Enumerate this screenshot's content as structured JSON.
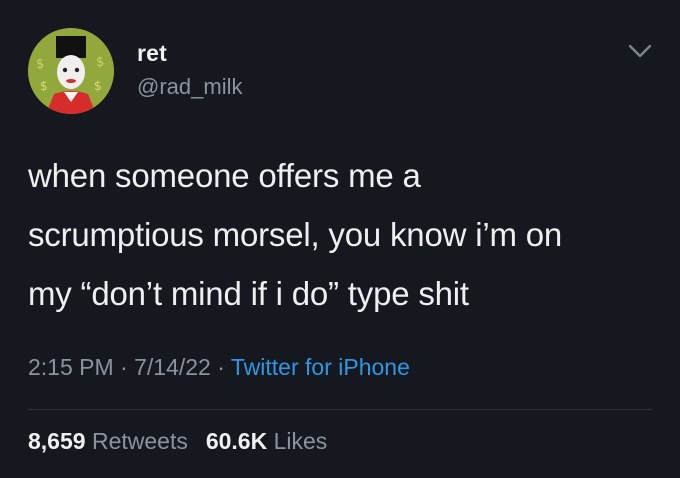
{
  "user": {
    "display_name": "ret",
    "handle": "@rad_milk",
    "avatar_icon": "profile-photo-clown-figure"
  },
  "tweet": {
    "lines": [
      "when someone offers me a",
      "scrumptious morsel, you know i’m on",
      "my “don’t mind if i do” type shit"
    ],
    "time": "2:15 PM",
    "separator": " · ",
    "date": "7/14/22",
    "source": "Twitter for iPhone"
  },
  "stats": {
    "retweets_count": "8,659",
    "retweets_label": "Retweets",
    "likes_count": "60.6K",
    "likes_label": "Likes"
  },
  "colors": {
    "background": "#15181f",
    "text": "#edeff0",
    "muted": "#8b949c",
    "link": "#2f97e2"
  },
  "icons": {
    "menu": "chevron-down-icon"
  }
}
